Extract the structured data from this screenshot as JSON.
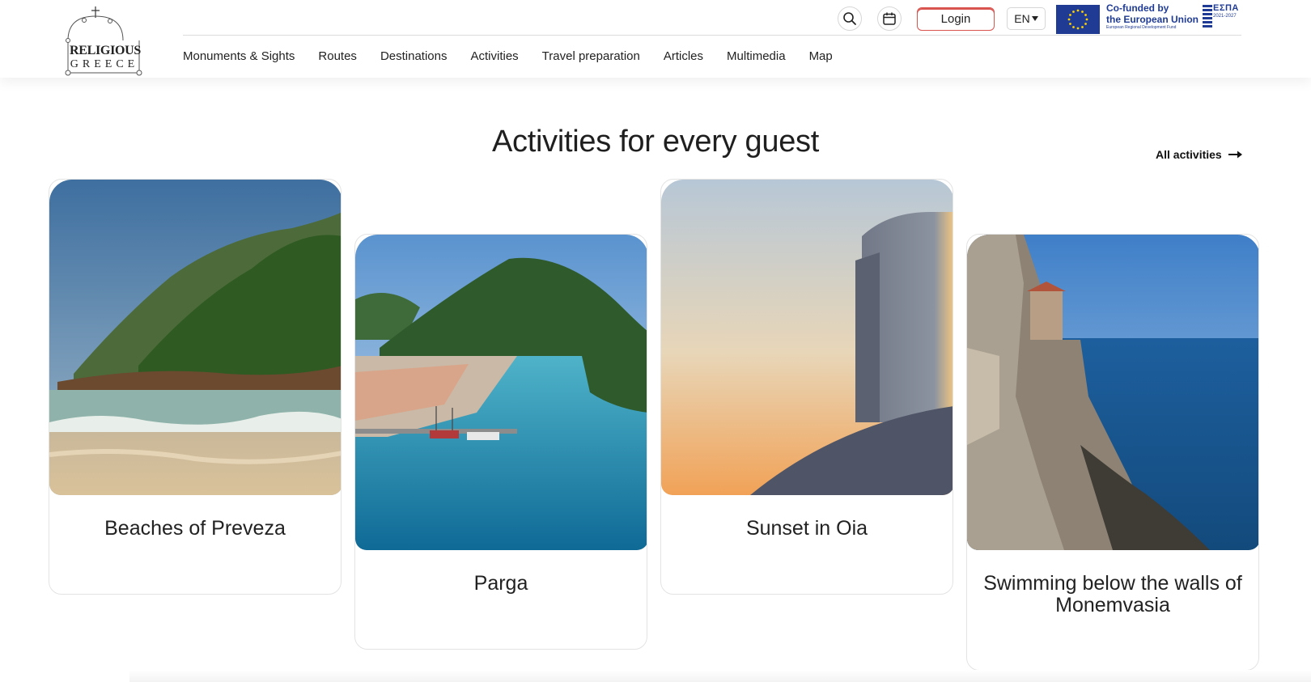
{
  "header": {
    "logo": {
      "line1": "RELIGIOUS",
      "line2": "GREECE"
    },
    "nav": [
      {
        "label": "Monuments & Sights"
      },
      {
        "label": "Routes"
      },
      {
        "label": "Destinations"
      },
      {
        "label": "Activities"
      },
      {
        "label": "Travel preparation"
      },
      {
        "label": "Articles"
      },
      {
        "label": "Multimedia"
      },
      {
        "label": "Map"
      }
    ],
    "icons": {
      "search": "search-icon",
      "calendar": "calendar-icon"
    },
    "login_label": "Login",
    "language": "EN",
    "eu_badge": {
      "line1": "Co-funded by",
      "line2": "the European Union",
      "line3": "European Regional Development Fund",
      "espa_title": "ΕΣΠΑ",
      "espa_years": "2021-2027"
    }
  },
  "section": {
    "title": "Activities for every guest",
    "all_link": "All activities"
  },
  "cards": [
    {
      "title": "Beaches of Preveza"
    },
    {
      "title": "Parga"
    },
    {
      "title": "Sunset in Oia"
    },
    {
      "title": "Swimming below the walls of Monemvasia"
    }
  ],
  "colors": {
    "accent": "#d9534f",
    "eu_blue": "#1f3b94",
    "eu_gold": "#ffd200",
    "text": "#1f1f1f"
  }
}
